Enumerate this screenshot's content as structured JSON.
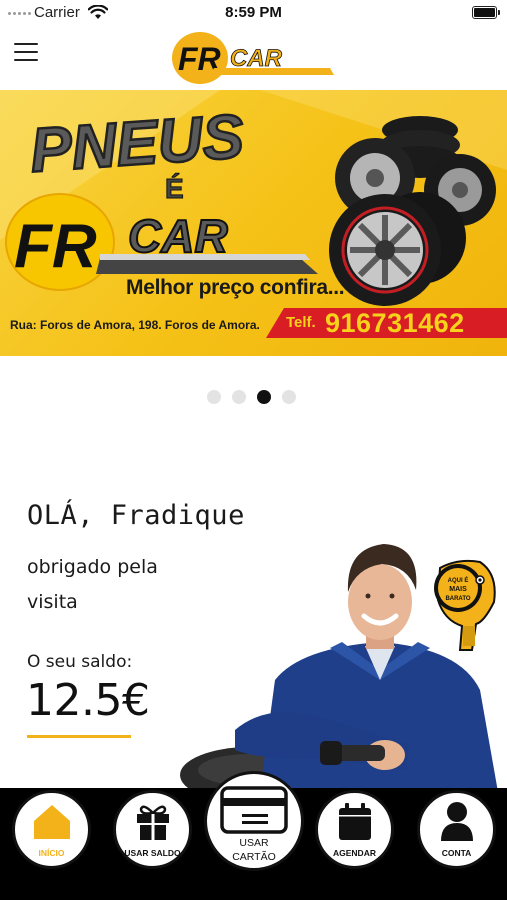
{
  "status_bar": {
    "carrier": "Carrier",
    "time": "8:59 PM",
    "icons": [
      "signal-dots-icon",
      "wifi-icon",
      "battery-icon"
    ]
  },
  "nav": {
    "menu_icon": "hamburger-icon",
    "logo_text": "FR CAR"
  },
  "banner": {
    "headline": "PNEUS",
    "connector": "É",
    "brand": "FR CAR",
    "tagline": "Melhor preço confira...",
    "address": "Rua: Foros de Amora, 198. Foros de Amora.",
    "phone_label": "Telf.",
    "phone_number": "916731462"
  },
  "carousel": {
    "page_count": 4,
    "active_index": 2
  },
  "greeting": {
    "hello": "OLÁ, Fradique",
    "thanks_line1": "obrigado pela",
    "thanks_line2": "visita",
    "balance_label": "O seu saldo:",
    "balance_value": "12.5€"
  },
  "mechanic_badge": "Aqui é mais barato",
  "tabs": [
    {
      "label": "INÍCIO",
      "icon": "home-icon",
      "active": true
    },
    {
      "label": "USAR SALDO",
      "icon": "gift-icon",
      "active": false
    },
    {
      "label_line1": "USAR",
      "label_line2": "CARTÃO",
      "icon": "card-icon",
      "active": false
    },
    {
      "label": "AGENDAR",
      "icon": "calendar-icon",
      "active": false
    },
    {
      "label": "CONTA",
      "icon": "person-icon",
      "active": false
    }
  ],
  "colors": {
    "accent": "#f3b21a",
    "banner_red": "#d81d24",
    "tabbar": "#000000"
  }
}
